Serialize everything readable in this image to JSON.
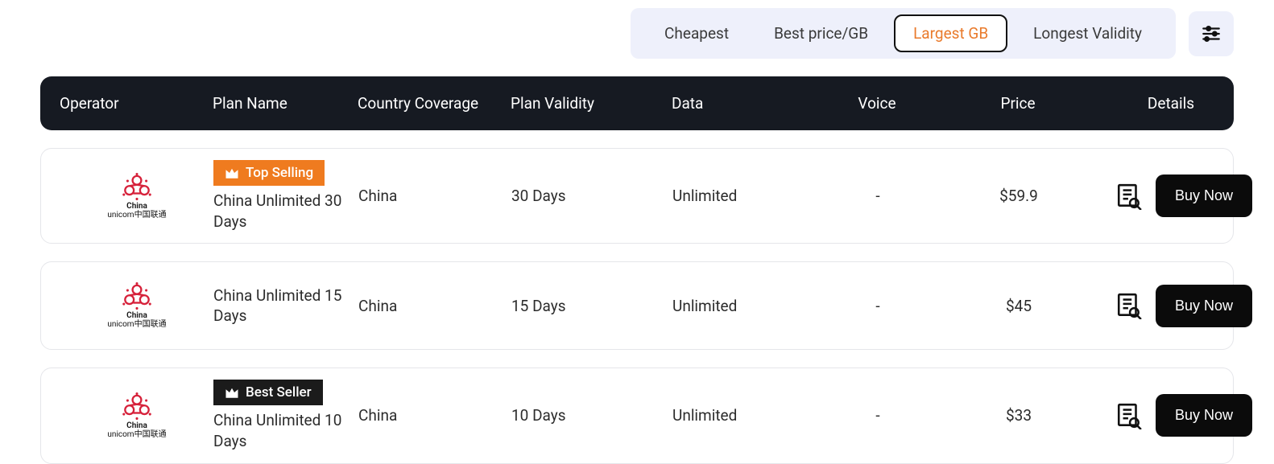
{
  "filters": {
    "tabs": [
      {
        "label": "Cheapest",
        "active": false
      },
      {
        "label": "Best price/GB",
        "active": false
      },
      {
        "label": "Largest GB",
        "active": true
      },
      {
        "label": "Longest Validity",
        "active": false
      }
    ]
  },
  "columns": {
    "operator": "Operator",
    "plan_name": "Plan Name",
    "country": "Country Coverage",
    "validity": "Plan Validity",
    "data": "Data",
    "voice": "Voice",
    "price": "Price",
    "details": "Details"
  },
  "operator_label": {
    "line1": "China",
    "line2": "unicom中国联通"
  },
  "rows": [
    {
      "badge": {
        "text": "Top Selling",
        "style": "orange"
      },
      "plan_name": "China Unlimited 30 Days",
      "country": "China",
      "validity": "30 Days",
      "data": "Unlimited",
      "voice": "-",
      "price": "$59.9",
      "buy_label": "Buy Now"
    },
    {
      "badge": null,
      "plan_name": "China Unlimited 15 Days",
      "country": "China",
      "validity": "15 Days",
      "data": "Unlimited",
      "voice": "-",
      "price": "$45",
      "buy_label": "Buy Now"
    },
    {
      "badge": {
        "text": "Best Seller",
        "style": "black"
      },
      "plan_name": "China Unlimited 10 Days",
      "country": "China",
      "validity": "10 Days",
      "data": "Unlimited",
      "voice": "-",
      "price": "$33",
      "buy_label": "Buy Now"
    }
  ]
}
